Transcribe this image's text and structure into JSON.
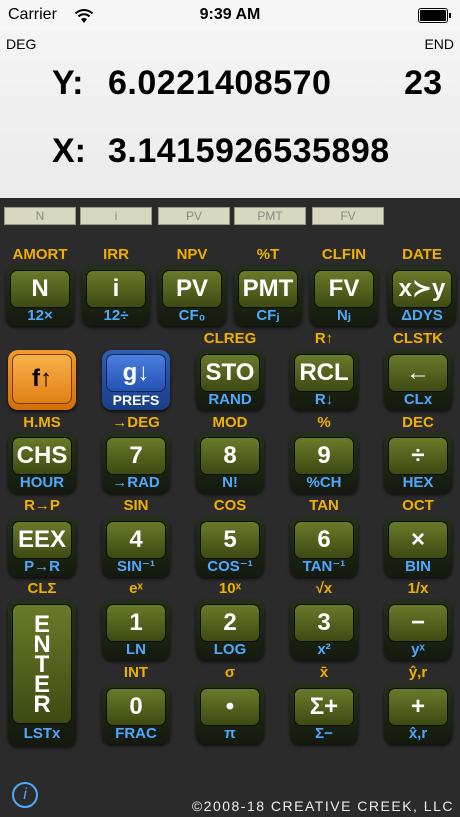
{
  "status": {
    "carrier": "Carrier",
    "time": "9:39 AM"
  },
  "display": {
    "mode_left": "DEG",
    "mode_right": "END",
    "y_label": "Y:",
    "y_value": "6.0221408570",
    "y_exp": "23",
    "x_label": "X:",
    "x_value": "3.1415926535898"
  },
  "annunciators": [
    "N",
    "i",
    "PV",
    "PMT",
    "FV"
  ],
  "rows": [
    {
      "tops": [
        "AMORT",
        "IRR",
        "NPV",
        "%T",
        "CLFIN",
        "DATE"
      ],
      "keys": [
        {
          "label": "N",
          "sub": "12×"
        },
        {
          "label": "i",
          "sub": "12÷"
        },
        {
          "label": "PV",
          "sub": "CF₀"
        },
        {
          "label": "PMT",
          "sub": "CFⱼ"
        },
        {
          "label": "FV",
          "sub": "Nⱼ"
        },
        {
          "label": "x≻y",
          "sub": "ΔDYS"
        }
      ]
    },
    {
      "tops": [
        "",
        "",
        "CLREG",
        "R↑",
        "CLSTK"
      ],
      "keys": [
        {
          "label": "f↑",
          "sub": ""
        },
        {
          "label": "g↓",
          "sub": "PREFS"
        },
        {
          "label": "STO",
          "sub": "RAND"
        },
        {
          "label": "RCL",
          "sub": "R↓"
        },
        {
          "label": "←",
          "sub": "CLx"
        }
      ]
    },
    {
      "tops": [
        "H.MS",
        "→DEG",
        "MOD",
        "%",
        "DEC"
      ],
      "keys": [
        {
          "label": "CHS",
          "sub": "HOUR"
        },
        {
          "label": "7",
          "sub": "→RAD"
        },
        {
          "label": "8",
          "sub": "N!"
        },
        {
          "label": "9",
          "sub": "%CH"
        },
        {
          "label": "÷",
          "sub": "HEX"
        }
      ]
    },
    {
      "tops": [
        "R→P",
        "SIN",
        "COS",
        "TAN",
        "OCT"
      ],
      "keys": [
        {
          "label": "EEX",
          "sub": "P→R"
        },
        {
          "label": "4",
          "sub": "SIN⁻¹"
        },
        {
          "label": "5",
          "sub": "COS⁻¹"
        },
        {
          "label": "6",
          "sub": "TAN⁻¹"
        },
        {
          "label": "×",
          "sub": "BIN"
        }
      ]
    },
    {
      "tops": [
        "CLΣ",
        "eˣ",
        "10ˣ",
        "√x",
        "1/x"
      ],
      "keys": [
        {
          "label": "1",
          "sub": "LN"
        },
        {
          "label": "2",
          "sub": "LOG"
        },
        {
          "label": "3",
          "sub": "x²"
        },
        {
          "label": "−",
          "sub": "yˣ"
        }
      ]
    },
    {
      "tops": [
        "INT",
        "σ",
        "x̄",
        "ŷ,r"
      ],
      "keys": [
        {
          "label": "0",
          "sub": "FRAC"
        },
        {
          "label": "•",
          "sub": "π"
        },
        {
          "label": "Σ+",
          "sub": "Σ−"
        },
        {
          "label": "+",
          "sub": "x̂,r"
        }
      ]
    }
  ],
  "enter": {
    "letters": [
      "E",
      "N",
      "T",
      "E",
      "R"
    ],
    "sub": "LSTx"
  },
  "footer": {
    "copyright": "©2008-18 CREATIVE CREEK, LLC",
    "info": "i"
  }
}
